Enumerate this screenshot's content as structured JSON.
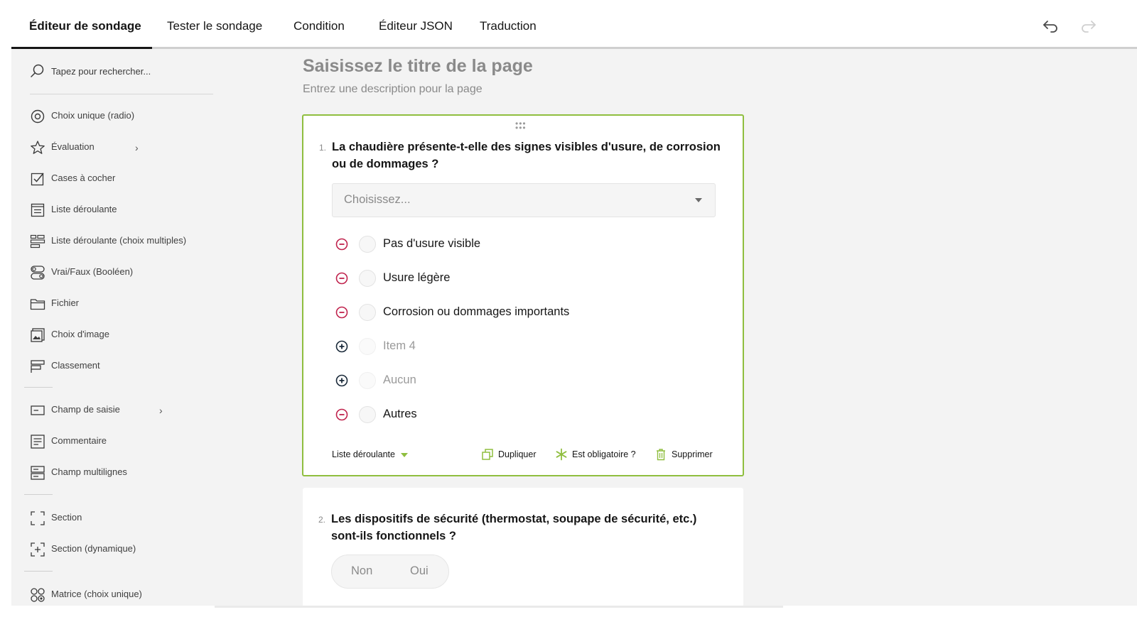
{
  "tabs": [
    {
      "label": "Éditeur de sondage",
      "active": true
    },
    {
      "label": "Tester le sondage"
    },
    {
      "label": "Condition"
    },
    {
      "label": "Éditeur JSON"
    },
    {
      "label": "Traduction"
    }
  ],
  "toolbar": {
    "undo_icon": "undo-icon",
    "redo_icon": "redo-icon"
  },
  "sidebar": {
    "search_placeholder": "Tapez pour rechercher...",
    "tools": [
      {
        "label": "Choix unique (radio)",
        "icon": "radio-icon"
      },
      {
        "label": "Évaluation",
        "icon": "star-icon",
        "submenu": true
      },
      {
        "label": "Cases à cocher",
        "icon": "checkbox-icon"
      },
      {
        "label": "Liste déroulante",
        "icon": "dropdown-icon"
      },
      {
        "label": "Liste déroulante (choix multiples)",
        "icon": "tagbox-icon"
      },
      {
        "label": "Vrai/Faux (Booléen)",
        "icon": "boolean-icon"
      },
      {
        "label": "Fichier",
        "icon": "folder-icon"
      },
      {
        "label": "Choix d'image",
        "icon": "image-icon"
      },
      {
        "label": "Classement",
        "icon": "ranking-icon"
      },
      {
        "label": "Champ de saisie",
        "icon": "text-input-icon",
        "submenu": true
      },
      {
        "label": "Commentaire",
        "icon": "comment-icon"
      },
      {
        "label": "Champ multilignes",
        "icon": "multiline-icon"
      },
      {
        "label": "Section",
        "icon": "section-icon"
      },
      {
        "label": "Section (dynamique)",
        "icon": "dynamic-section-icon"
      },
      {
        "label": "Matrice (choix unique)",
        "icon": "matrix-icon"
      }
    ]
  },
  "page": {
    "title": "Saisissez le titre de la page",
    "description": "Entrez une description pour la page"
  },
  "question1": {
    "number": "1.",
    "title": "La chaudière présente-t-elle des signes visibles d'usure, de corrosion ou de dommages ?",
    "placeholder": "Choisissez...",
    "choices": [
      {
        "text": "Pas d'usure visible",
        "state": "remove"
      },
      {
        "text": "Usure légère",
        "state": "remove"
      },
      {
        "text": "Corrosion ou dommages importants",
        "state": "remove"
      },
      {
        "text": "Item 4",
        "state": "add"
      },
      {
        "text": "Aucun",
        "state": "add"
      },
      {
        "text": "Autres",
        "state": "remove"
      }
    ],
    "type_label": "Liste déroulante",
    "actions": {
      "duplicate": "Dupliquer",
      "required": "Est obligatoire ?",
      "delete": "Supprimer"
    }
  },
  "question2": {
    "number": "2.",
    "title": "Les dispositifs de sécurité (thermostat, soupape de sécurité, etc.) sont-ils fonctionnels ?",
    "false_label": "Non",
    "true_label": "Oui"
  },
  "colors": {
    "accent": "#8fbe3f",
    "remove": "#c0234d",
    "add": "#1a2a3a",
    "canvas": "#f3f3f3"
  }
}
